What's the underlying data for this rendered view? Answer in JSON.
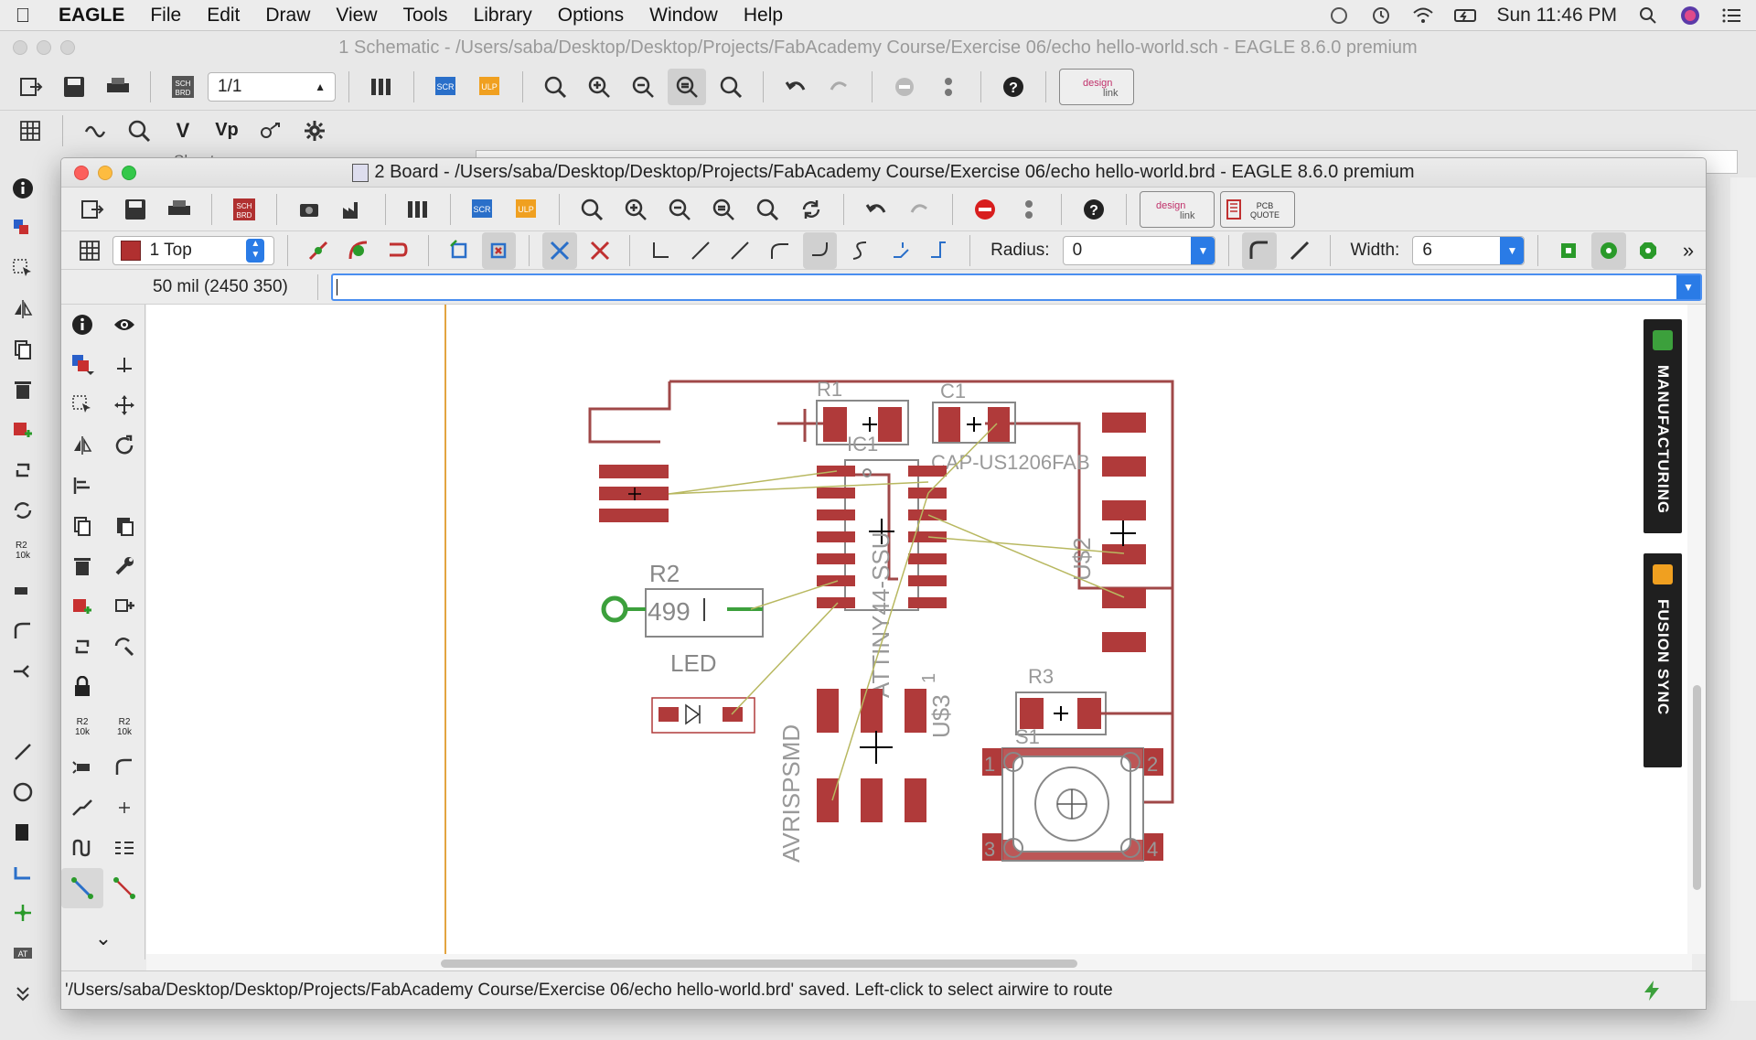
{
  "menubar": {
    "app": "EAGLE",
    "items": [
      "File",
      "Edit",
      "Draw",
      "View",
      "Tools",
      "Library",
      "Options",
      "Window",
      "Help"
    ],
    "clock": "Sun 11:46 PM"
  },
  "schematic_window": {
    "title": "1 Schematic - /Users/saba/Desktop/Desktop/Projects/FabAcademy Course/Exercise 06/echo hello-world.sch - EAGLE 8.6.0 premium",
    "sheet_select": "1/1",
    "sheets_label": "Sheets"
  },
  "board_window": {
    "title": "2 Board - /Users/saba/Desktop/Desktop/Projects/FabAcademy Course/Exercise 06/echo hello-world.brd - EAGLE 8.6.0 premium",
    "layer_select": "1 Top",
    "radius_label": "Radius:",
    "radius_value": "0",
    "width_label": "Width:",
    "width_value": "6",
    "coordinates": "50 mil (2450 350)",
    "command_value": "",
    "status": "'/Users/saba/Desktop/Desktop/Projects/FabAcademy Course/Exercise 06/echo hello-world.brd' saved. Left-click to select airwire to route",
    "side_tabs": [
      "MANUFACTURING",
      "FUSION SYNC"
    ],
    "designlink_label_1": "design",
    "designlink_label_2": "link",
    "pcb_quote_label_1": "PCB",
    "pcb_quote_label_2": "QUOTE"
  },
  "pcb": {
    "labels": {
      "r1": "R1",
      "c1": "C1",
      "ic1": "IC1",
      "cap": "CAP-US1206FAB",
      "r2": "R2",
      "r2_value": "499",
      "led": "LED",
      "attiny": "ATTINY44-SSU",
      "us2": "U$2",
      "us3": "U$3",
      "r3": "R3",
      "s1": "S1",
      "avrisp": "AVRISPSMD",
      "pin1": "1",
      "pin2": "2",
      "pin3": "3",
      "pin4": "4",
      "pin1b": "1"
    },
    "colors": {
      "pad": "#b03a3a",
      "outline": "#a04848",
      "airwire": "#b8b860",
      "via": "#3ca03c",
      "origin_line": "#e3a440"
    }
  }
}
